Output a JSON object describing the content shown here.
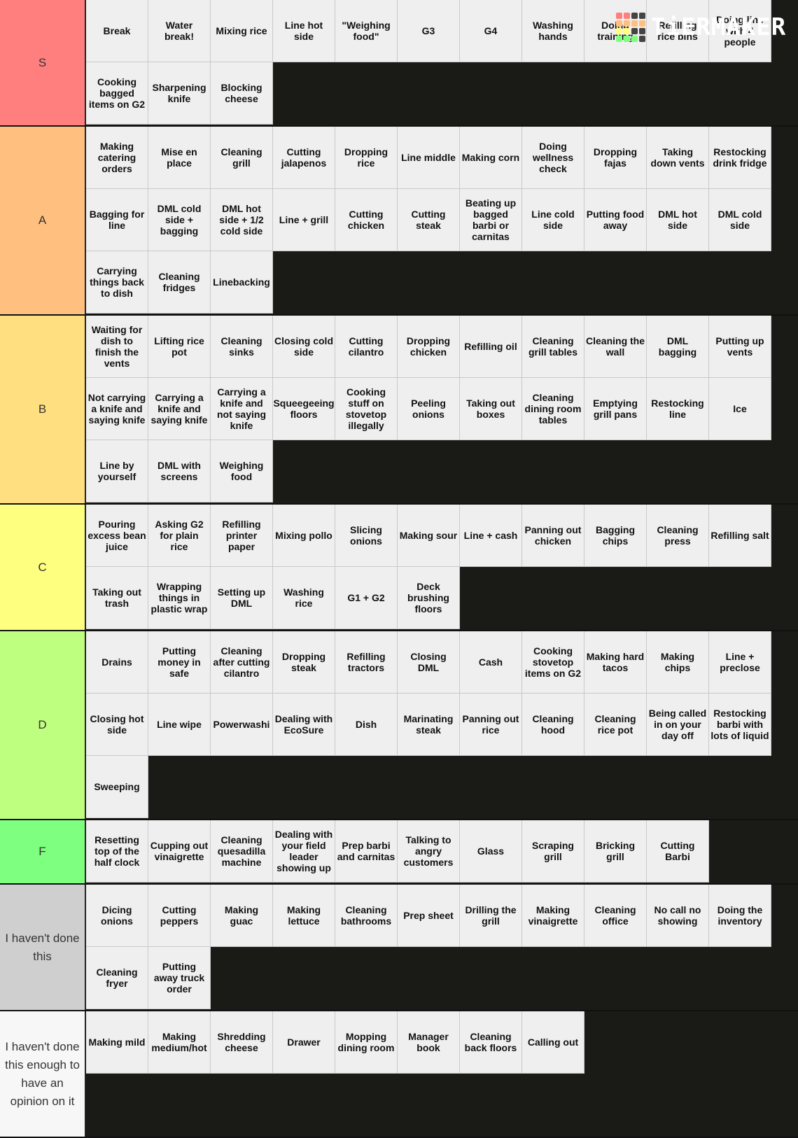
{
  "logo": {
    "text": "TiERMAKER",
    "grid_colors": [
      "#ff7f7f",
      "#ff7f7f",
      "#444444",
      "#444444",
      "#ffbf7f",
      "#ffbf7f",
      "#ffbf7f",
      "#ffbf7f",
      "#ffff7f",
      "#ffff7f",
      "#444444",
      "#444444",
      "#7fff7f",
      "#7fff7f",
      "#7fff7f",
      "#444444"
    ]
  },
  "tiers": [
    {
      "label": "S",
      "color": "#ff7f7f",
      "rows": 2,
      "items": [
        "Break",
        "Water break!",
        "Mixing rice",
        "Line hot side",
        "\"Weighing food\"",
        "G3",
        "G4",
        "Washing hands",
        "Doing training",
        "Refilling rice bins",
        "Doing line with 4 people",
        "Cooking bagged items on G2",
        "Sharpening knife",
        "Blocking cheese"
      ]
    },
    {
      "label": "A",
      "color": "#ffbf7f",
      "rows": 3,
      "items": [
        "Making catering orders",
        "Mise en place",
        "Cleaning grill",
        "Cutting jalapenos",
        "Dropping rice",
        "Line middle",
        "Making corn",
        "Doing wellness check",
        "Dropping fajas",
        "Taking down vents",
        "Restocking drink fridge",
        "Bagging for line",
        "DML cold side + bagging",
        "DML hot side + 1/2 cold side",
        "Line + grill",
        "Cutting chicken",
        "Cutting steak",
        "Beating up bagged barbi or carnitas",
        "Line cold side",
        "Putting food away",
        "DML hot side",
        "DML cold side",
        "Carrying things back to dish",
        "Cleaning fridges",
        "Linebacking"
      ]
    },
    {
      "label": "B",
      "color": "#ffdf7f",
      "rows": 3,
      "items": [
        "Waiting for dish to finish the vents",
        "Lifting rice pot",
        "Cleaning sinks",
        "Closing cold side",
        "Cutting cilantro",
        "Dropping chicken",
        "Refilling oil",
        "Cleaning grill tables",
        "Cleaning the wall",
        "DML bagging",
        "Putting up vents",
        "Not carrying a knife and saying knife",
        "Carrying a knife and saying knife",
        "Carrying a knife and not saying knife",
        "Squeegeeing floors",
        "Cooking stuff on stovetop illegally",
        "Peeling onions",
        "Taking out boxes",
        "Cleaning dining room tables",
        "Emptying grill pans",
        "Restocking line",
        "Ice",
        "Line by yourself",
        "DML with screens",
        "Weighing food"
      ]
    },
    {
      "label": "C",
      "color": "#ffff7f",
      "rows": 2,
      "items": [
        "Pouring excess bean juice",
        "Asking G2 for plain rice",
        "Refilling printer paper",
        "Mixing pollo",
        "Slicing onions",
        "Making sour",
        "Line + cash",
        "Panning out chicken",
        "Bagging chips",
        "Cleaning press",
        "Refilling salt",
        "Taking out trash",
        "Wrapping things in plastic wrap",
        "Setting up DML",
        "Washing rice",
        "G1 + G2",
        "Deck brushing floors"
      ]
    },
    {
      "label": "D",
      "color": "#bfff7f",
      "rows": 3,
      "items": [
        "Drains",
        "Putting money in safe",
        "Cleaning after cutting cilantro",
        "Dropping steak",
        "Refilling tractors",
        "Closing DML",
        "Cash",
        "Cooking stovetop items on G2",
        "Making hard tacos",
        "Making chips",
        "Line + preclose",
        "Closing hot side",
        "Line wipe",
        "Powerwashi",
        "Dealing with EcoSure",
        "Dish",
        "Marinating steak",
        "Panning out rice",
        "Cleaning hood",
        "Cleaning rice pot",
        "Being called in on your day off",
        "Restocking barbi with lots of liquid",
        "Sweeping"
      ]
    },
    {
      "label": "F",
      "color": "#7fff7f",
      "rows": 1,
      "items": [
        "Resetting top of the half clock",
        "Cupping out vinaigrette",
        "Cleaning quesadilla machine",
        "Dealing with your field leader showing up",
        "Prep barbi and carnitas",
        "Talking to angry customers",
        "Glass",
        "Scraping grill",
        "Bricking grill",
        "Cutting Barbi"
      ]
    },
    {
      "label": "I haven't done this",
      "color": "#cfcfcf",
      "rows": 2,
      "items": [
        "Dicing onions",
        "Cutting peppers",
        "Making guac",
        "Making lettuce",
        "Cleaning bathrooms",
        "Prep sheet",
        "Drilling the grill",
        "Making vinaigrette",
        "Cleaning office",
        "No call no showing",
        "Doing the inventory",
        "Cleaning fryer",
        "Putting away truck order"
      ]
    },
    {
      "label": "I haven't done this enough to have an opinion on it",
      "color": "#f7f7f7",
      "rows": 2,
      "items": [
        "Making mild",
        "Making medium/hot",
        "Shredding cheese",
        "Drawer",
        "Mopping dining room",
        "Manager book",
        "Cleaning back floors",
        "Calling out"
      ]
    }
  ]
}
